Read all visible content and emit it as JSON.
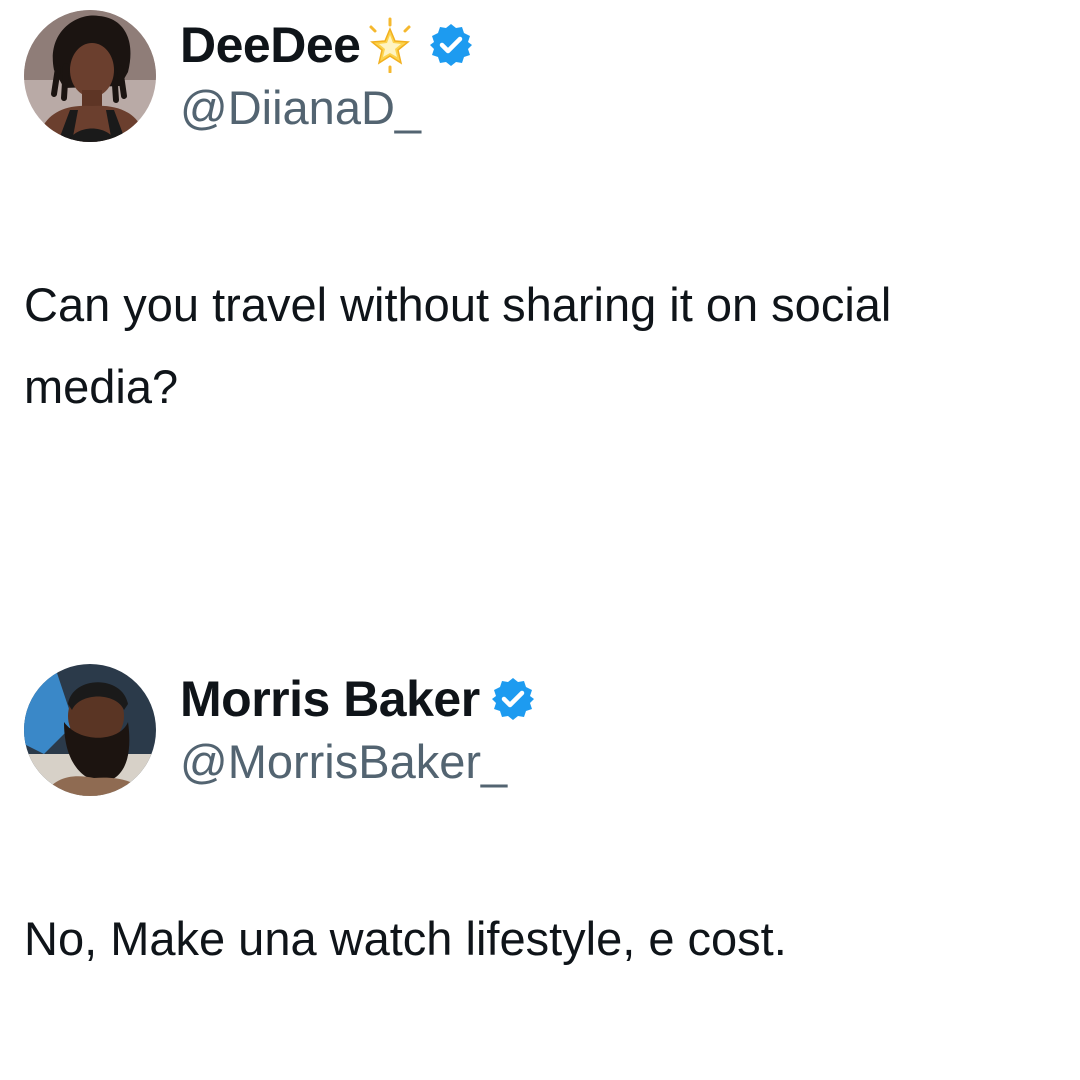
{
  "tweets": [
    {
      "display_name": "DeeDee",
      "handle": "@DiianaD_",
      "has_star_emoji": true,
      "verified": true,
      "avatar": "woman-portrait-avatar",
      "text": "Can you travel without sharing it on social media?"
    },
    {
      "display_name": "Morris Baker",
      "handle": "@MorrisBaker_",
      "has_star_emoji": false,
      "verified": true,
      "avatar": "bearded-man-portrait-avatar",
      "text": "No, Make una watch lifestyle, e cost."
    }
  ],
  "colors": {
    "verified_badge": "#1d9bf0",
    "handle": "#536471",
    "text": "#0f1419",
    "star": "#f7c948"
  }
}
